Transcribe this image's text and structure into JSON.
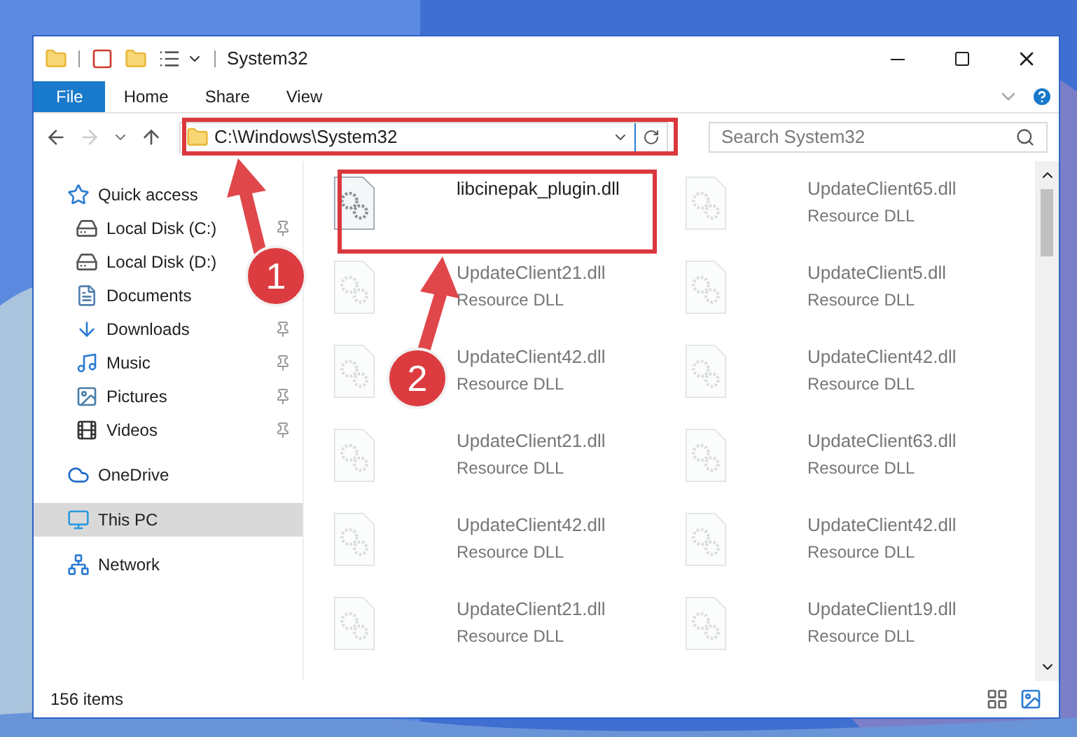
{
  "window": {
    "title": "System32"
  },
  "ribbon": {
    "tabs": [
      {
        "label": "File",
        "selected": true
      },
      {
        "label": "Home",
        "selected": false
      },
      {
        "label": "Share",
        "selected": false
      },
      {
        "label": "View",
        "selected": false
      }
    ]
  },
  "address": {
    "path": "C:\\Windows\\System32"
  },
  "search": {
    "placeholder": "Search System32"
  },
  "sidebar": {
    "items": [
      {
        "label": "Quick access",
        "selected": false,
        "children": [
          {
            "label": "Local Disk (C:)",
            "pinned": true
          },
          {
            "label": "Local Disk (D:)"
          },
          {
            "label": "Documents"
          },
          {
            "label": "Downloads",
            "pinned": true
          },
          {
            "label": "Music",
            "pinned": true
          },
          {
            "label": "Pictures",
            "pinned": true
          },
          {
            "label": "Videos",
            "pinned": true
          }
        ]
      },
      {
        "label": "OneDrive",
        "selected": false
      },
      {
        "label": "This PC",
        "selected": true
      },
      {
        "label": "Network",
        "selected": false
      }
    ]
  },
  "files": [
    {
      "name": "libcinepak_plugin.dll",
      "faded": false
    },
    {
      "name": "UpdateClient65.dll",
      "type": "Resource DLL",
      "faded": true
    },
    {
      "name": "UpdateClient21.dll",
      "type": "Resource DLL",
      "faded": true
    },
    {
      "name": "UpdateClient5.dll",
      "type": "Resource DLL",
      "faded": true
    },
    {
      "name": "UpdateClient42.dll",
      "type": "Resource DLL",
      "faded": true
    },
    {
      "name": "UpdateClient42.dll",
      "type": "Resource DLL",
      "faded": true
    },
    {
      "name": "UpdateClient21.dll",
      "type": "Resource DLL",
      "faded": true
    },
    {
      "name": "UpdateClient63.dll",
      "type": "Resource DLL",
      "faded": true
    },
    {
      "name": "UpdateClient42.dll",
      "type": "Resource DLL",
      "faded": true
    },
    {
      "name": "UpdateClient42.dll",
      "type": "Resource DLL",
      "faded": true
    },
    {
      "name": "UpdateClient21.dll",
      "type": "Resource DLL",
      "faded": true
    },
    {
      "name": "UpdateClient19.dll",
      "type": "Resource DLL",
      "faded": true
    }
  ],
  "status_bar": {
    "count": "156 items"
  },
  "annotations": [
    {
      "label": "1"
    },
    {
      "label": "2"
    }
  ]
}
